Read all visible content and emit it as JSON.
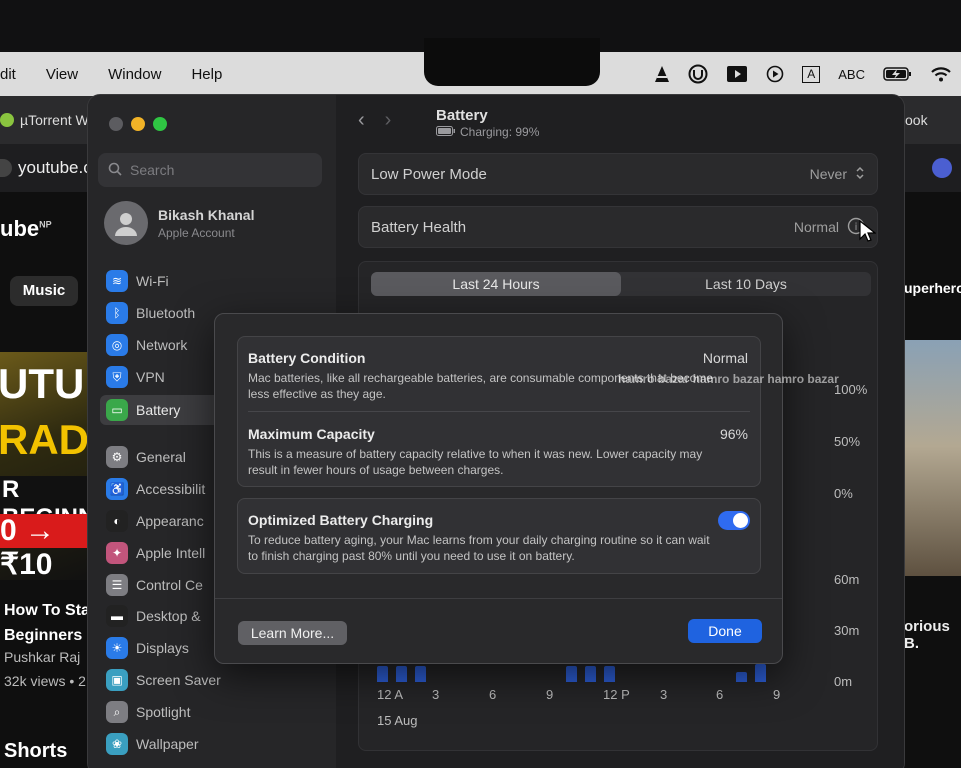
{
  "menubar": {
    "items": [
      "dit",
      "View",
      "Window",
      "Help"
    ],
    "input_source": "ABC",
    "input_badge": "A"
  },
  "browser": {
    "tab_title": "µTorrent W",
    "tab_right": "ook",
    "address": "youtube.c",
    "yt_logo": "ube",
    "yt_region": "NP",
    "chip": "Music",
    "chip_right": "uperhero",
    "thumb_text": [
      "UTUR",
      "RADI",
      "R BEGINNE",
      "0 → ₹10"
    ],
    "video_title": [
      "How To Sta",
      "Beginners"
    ],
    "channel": "Pushkar Raj",
    "views": "32k views • 2",
    "right_title": "orious B.",
    "shorts": "Shorts"
  },
  "sidebar": {
    "search_placeholder": "Search",
    "account_name": "Bikash Khanal",
    "account_sub": "Apple Account",
    "items": [
      {
        "label": "Wi-Fi",
        "color": "#2a7be8"
      },
      {
        "label": "Bluetooth",
        "color": "#2a7be8"
      },
      {
        "label": "Network",
        "color": "#2a7be8"
      },
      {
        "label": "VPN",
        "color": "#2a7be8"
      },
      {
        "label": "Battery",
        "color": "#3aa84a"
      },
      {
        "label": "General",
        "color": "#7d7d82"
      },
      {
        "label": "Accessibilit",
        "color": "#2a7be8"
      },
      {
        "label": "Appearanc",
        "color": "#222"
      },
      {
        "label": "Apple Intell",
        "color": "#c2557c"
      },
      {
        "label": "Control Ce",
        "color": "#7d7d82"
      },
      {
        "label": "Desktop &",
        "color": "#222"
      },
      {
        "label": "Displays",
        "color": "#2a7be8"
      },
      {
        "label": "Screen Saver",
        "color": "#3a9fc0"
      },
      {
        "label": "Spotlight",
        "color": "#7d7d82"
      },
      {
        "label": "Wallpaper",
        "color": "#3a9fc0"
      }
    ]
  },
  "content": {
    "title": "Battery",
    "subtitle": "Charging: 99%",
    "low_power_label": "Low Power Mode",
    "low_power_value": "Never",
    "health_label": "Battery Health",
    "health_value": "Normal",
    "tab_24h": "Last 24 Hours",
    "tab_10d": "Last 10 Days"
  },
  "chart_data": {
    "type": "bar",
    "y_level_ticks": [
      "100%",
      "50%",
      "0%"
    ],
    "y_usage_ticks": [
      "60m",
      "30m",
      "0m"
    ],
    "x_ticks": [
      "12 A",
      "3",
      "6",
      "9",
      "12 P",
      "3",
      "6",
      "9"
    ],
    "x_date": "15 Aug"
  },
  "modal": {
    "condition_title": "Battery Condition",
    "condition_value": "Normal",
    "condition_desc": "Mac batteries, like all rechargeable batteries, are consumable components that become less effective as they age.",
    "capacity_title": "Maximum Capacity",
    "capacity_value": "96%",
    "capacity_desc": "This is a measure of battery capacity relative to when it was new. Lower capacity may result in fewer hours of usage between charges.",
    "optimized_title": "Optimized Battery Charging",
    "optimized_desc": "To reduce battery aging, your Mac learns from your daily charging routine so it can wait to finish charging past 80% until you need to use it on battery.",
    "optimized_on": true,
    "learn_more": "Learn More...",
    "done": "Done"
  },
  "watermark": "hamro bazar   hamro bazar   hamro bazar"
}
